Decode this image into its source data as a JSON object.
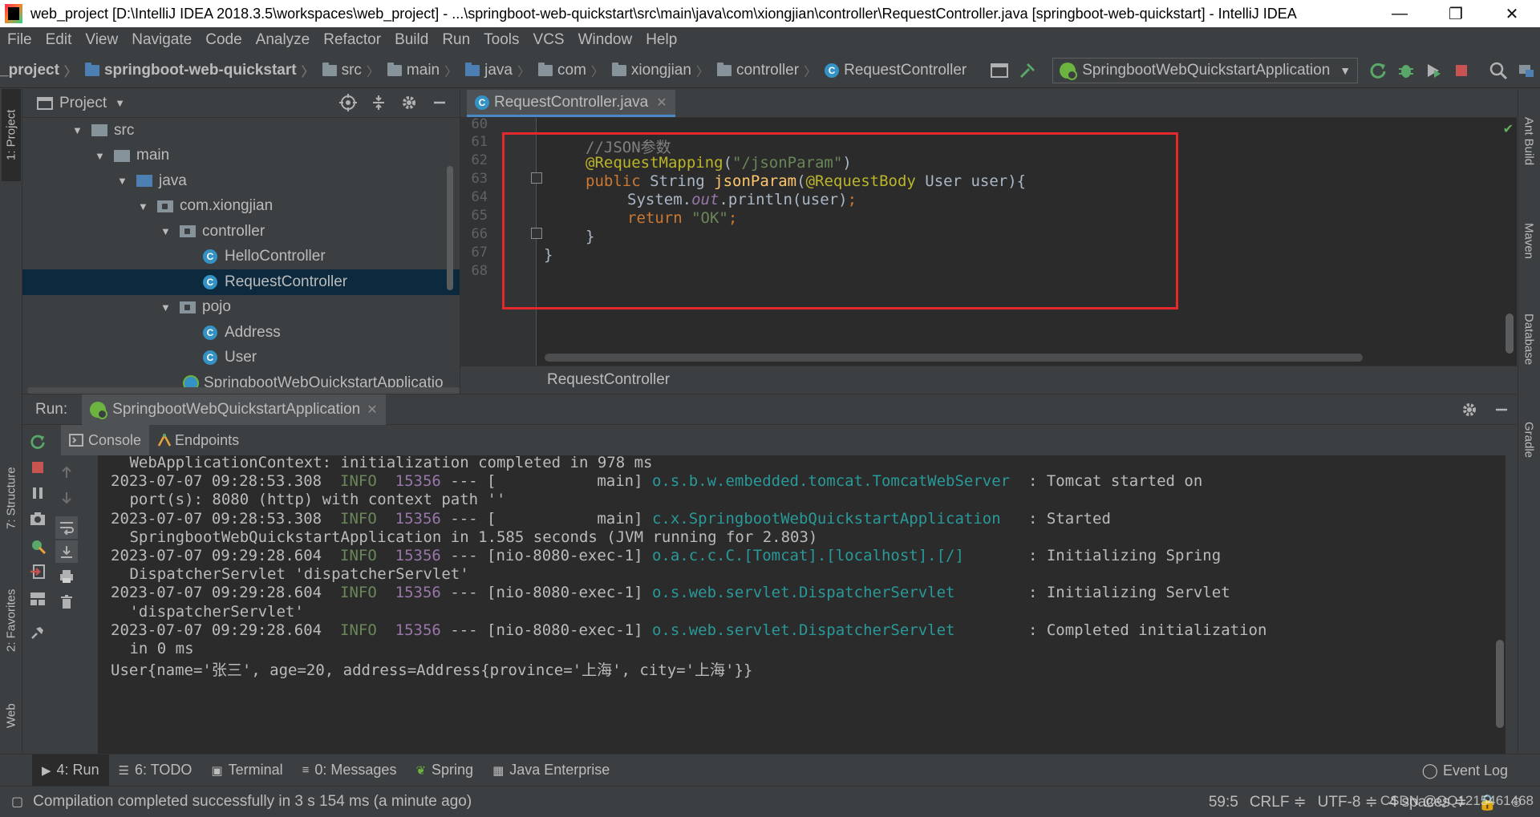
{
  "window": {
    "title": "web_project [D:\\IntelliJ IDEA 2018.3.5\\workspaces\\web_project] - ...\\springboot-web-quickstart\\src\\main\\java\\com\\xiongjian\\controller\\RequestController.java [springboot-web-quickstart] - IntelliJ IDEA",
    "minimize": "—",
    "maximize": "❐",
    "close": "✕"
  },
  "menu": [
    "File",
    "Edit",
    "View",
    "Navigate",
    "Code",
    "Analyze",
    "Refactor",
    "Build",
    "Run",
    "Tools",
    "VCS",
    "Window",
    "Help"
  ],
  "breadcrumb": [
    "_project",
    "springboot-web-quickstart",
    "src",
    "main",
    "java",
    "com",
    "xiongjian",
    "controller",
    "RequestController"
  ],
  "run_config": "SpringbootWebQuickstartApplication",
  "left_stripe": [
    "1: Project",
    "7: Structure",
    "2: Favorites",
    "Web"
  ],
  "right_stripe": [
    "Ant Build",
    "Maven",
    "Database",
    "Gradle"
  ],
  "project": {
    "header": "Project",
    "tree": [
      {
        "label": "src",
        "depth": 1,
        "type": "folder",
        "expanded": true
      },
      {
        "label": "main",
        "depth": 2,
        "type": "folder",
        "expanded": true
      },
      {
        "label": "java",
        "depth": 3,
        "type": "source-folder",
        "expanded": true
      },
      {
        "label": "com.xiongjian",
        "depth": 4,
        "type": "package",
        "expanded": true
      },
      {
        "label": "controller",
        "depth": 5,
        "type": "package",
        "expanded": true
      },
      {
        "label": "HelloController",
        "depth": 6,
        "type": "class"
      },
      {
        "label": "RequestController",
        "depth": 6,
        "type": "class",
        "selected": true
      },
      {
        "label": "pojo",
        "depth": 5,
        "type": "package",
        "expanded": true
      },
      {
        "label": "Address",
        "depth": 6,
        "type": "class"
      },
      {
        "label": "User",
        "depth": 6,
        "type": "class"
      },
      {
        "label": "SpringbootWebQuickstartApplicatio",
        "depth": 5,
        "type": "spring-class"
      }
    ]
  },
  "editor": {
    "tab": "RequestController.java",
    "line_numbers": [
      "60",
      "61",
      "62",
      "63",
      "64",
      "65",
      "66",
      "67",
      "68"
    ],
    "breadcrumb": "RequestController"
  },
  "run": {
    "label": "Run:",
    "tab": "SpringbootWebQuickstartApplication",
    "subtabs": [
      "Console",
      "Endpoints"
    ],
    "console": [
      {
        "text": " WebApplicationContext: initialization completed in 978 ms"
      },
      {
        "ts": "2023-07-07 09:28:53.308",
        "level": "INFO",
        "pid": "15356",
        "thread": " --- [           main] ",
        "logger": "o.s.b.w.embedded.tomcat.TomcatWebServer ",
        "msg": " : Tomcat started on"
      },
      {
        "text": " port(s): 8080 (http) with context path ''"
      },
      {
        "ts": "2023-07-07 09:28:53.308",
        "level": "INFO",
        "pid": "15356",
        "thread": " --- [           main] ",
        "logger": "c.x.SpringbootWebQuickstartApplication  ",
        "msg": " : Started"
      },
      {
        "text": " SpringbootWebQuickstartApplication in 1.585 seconds (JVM running for 2.803)"
      },
      {
        "ts": "2023-07-07 09:29:28.604",
        "level": "INFO",
        "pid": "15356",
        "thread": " --- [nio-8080-exec-1] ",
        "logger": "o.a.c.c.C.[Tomcat].[localhost].[/]      ",
        "msg": " : Initializing Spring"
      },
      {
        "text": " DispatcherServlet 'dispatcherServlet'"
      },
      {
        "ts": "2023-07-07 09:29:28.604",
        "level": "INFO",
        "pid": "15356",
        "thread": " --- [nio-8080-exec-1] ",
        "logger": "o.s.web.servlet.DispatcherServlet       ",
        "msg": " : Initializing Servlet"
      },
      {
        "text": " 'dispatcherServlet'"
      },
      {
        "ts": "2023-07-07 09:29:28.604",
        "level": "INFO",
        "pid": "15356",
        "thread": " --- [nio-8080-exec-1] ",
        "logger": "o.s.web.servlet.DispatcherServlet       ",
        "msg": " : Completed initialization"
      },
      {
        "text": " in 0 ms"
      },
      {
        "text": "User{name='张三', age=20, address=Address{province='上海', city='上海'}}"
      }
    ]
  },
  "bottom_tabs": [
    {
      "label": "4: Run",
      "icon": "play-icon",
      "active": true
    },
    {
      "label": "6: TODO",
      "icon": "list-icon"
    },
    {
      "label": "Terminal",
      "icon": "terminal-icon"
    },
    {
      "label": "0: Messages",
      "icon": "messages-icon"
    },
    {
      "label": "Spring",
      "icon": "spring-icon"
    },
    {
      "label": "Java Enterprise",
      "icon": "java-enterprise-icon"
    }
  ],
  "event_log": "Event Log",
  "status": {
    "message": "Compilation completed successfully in 3 s 154 ms (a minute ago)",
    "position": "59:5",
    "line_sep": "CRLF ≑",
    "encoding": "UTF-8 ≑",
    "indent": "4 spaces ≑",
    "watermark": "CSDN @QQ1215461468"
  },
  "colors": {
    "accent": "#4a88c7",
    "highlight_box": "#e4282b",
    "spring_green": "#6db33f",
    "selection": "#0d293e"
  }
}
